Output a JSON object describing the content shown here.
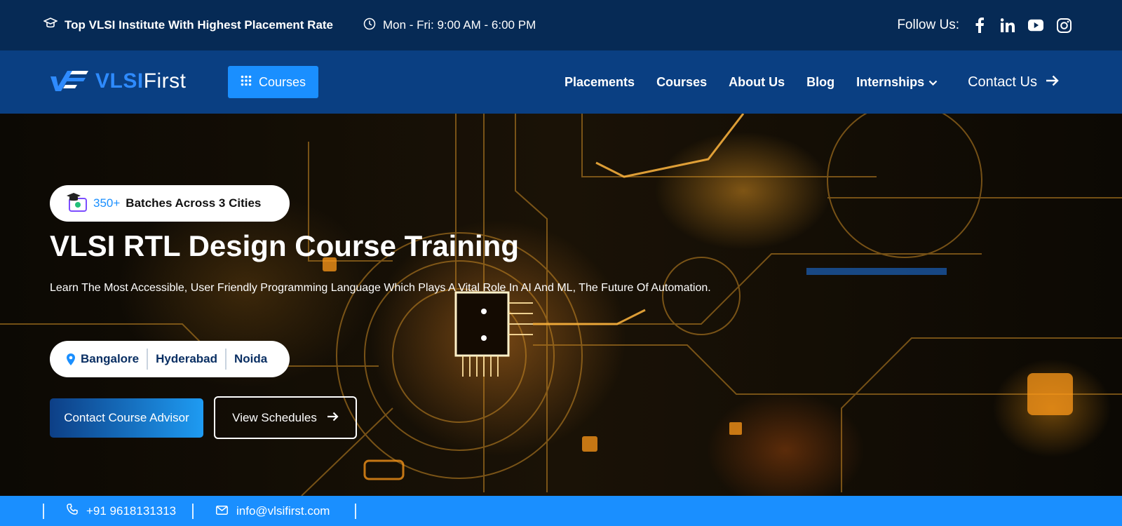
{
  "topbar": {
    "tagline": "Top VLSI Institute With Highest Placement Rate",
    "hours": "Mon - Fri: 9:00 AM - 6:00 PM",
    "follow_label": "Follow Us:",
    "socials": [
      "facebook-icon",
      "linkedin-icon",
      "youtube-icon",
      "instagram-icon"
    ]
  },
  "nav": {
    "logo_text_bold": "VLSI",
    "logo_text_light": "First",
    "courses_button": "Courses",
    "menu": [
      {
        "label": "Placements"
      },
      {
        "label": "Courses"
      },
      {
        "label": "About Us"
      },
      {
        "label": "Blog"
      },
      {
        "label": "Internships"
      }
    ],
    "contact": "Contact Us"
  },
  "hero": {
    "badge_count": "350+",
    "badge_text": "Batches Across 3 Cities",
    "title": "VLSI RTL Design Course Training",
    "description": "Learn The Most Accessible, User Friendly Programming Language Which Plays A Vital Role In AI And ML, The Future Of Automation.",
    "cities": [
      "Bangalore",
      "Hyderabad",
      "Noida"
    ],
    "primary_button": "Contact Course Advisor",
    "secondary_button": "View Schedules"
  },
  "bottombar": {
    "phone": "+91 9618131313",
    "email": "info@vlsifirst.com"
  },
  "colors": {
    "topbar_bg": "#062a55",
    "nav_bg": "#0a3f82",
    "accent": "#1a8fff"
  }
}
